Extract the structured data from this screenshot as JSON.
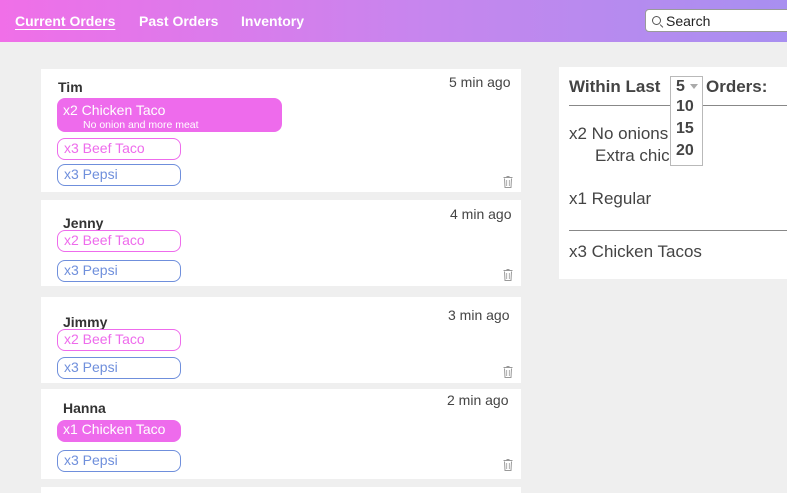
{
  "nav": {
    "current": "Current Orders",
    "past": "Past Orders",
    "inventory": "Inventory"
  },
  "search": {
    "placeholder": "Search"
  },
  "orders": [
    {
      "name": "Tim",
      "time": "5 min ago",
      "item1": "x2 Chicken Taco",
      "item1_note": "No onion and more meat",
      "item2": "x3 Beef Taco",
      "item3": "x3 Pepsi"
    },
    {
      "name": "Jenny",
      "time": "4 min ago",
      "item1": "x2 Beef Taco",
      "item2": "x3 Pepsi"
    },
    {
      "name": "Jimmy",
      "time": "3 min ago",
      "item1": "x2 Beef Taco",
      "item2": "x3 Pepsi"
    },
    {
      "name": "Hanna",
      "time": "2 min ago",
      "item1": "x1 Chicken Taco",
      "item2": "x3 Pepsi"
    }
  ],
  "summary": {
    "heading_pre": "Within Last",
    "heading_post": "Orders:",
    "selected": "5",
    "options": [
      "10",
      "15",
      "20"
    ],
    "line1": "x2 No onions",
    "line1_sub": "Extra chic",
    "line2": "x1 Regular",
    "line3": "x3 Chicken Tacos"
  },
  "colors": {
    "accent_pink": "#ee6bec",
    "accent_blue": "#6f8fdc"
  }
}
